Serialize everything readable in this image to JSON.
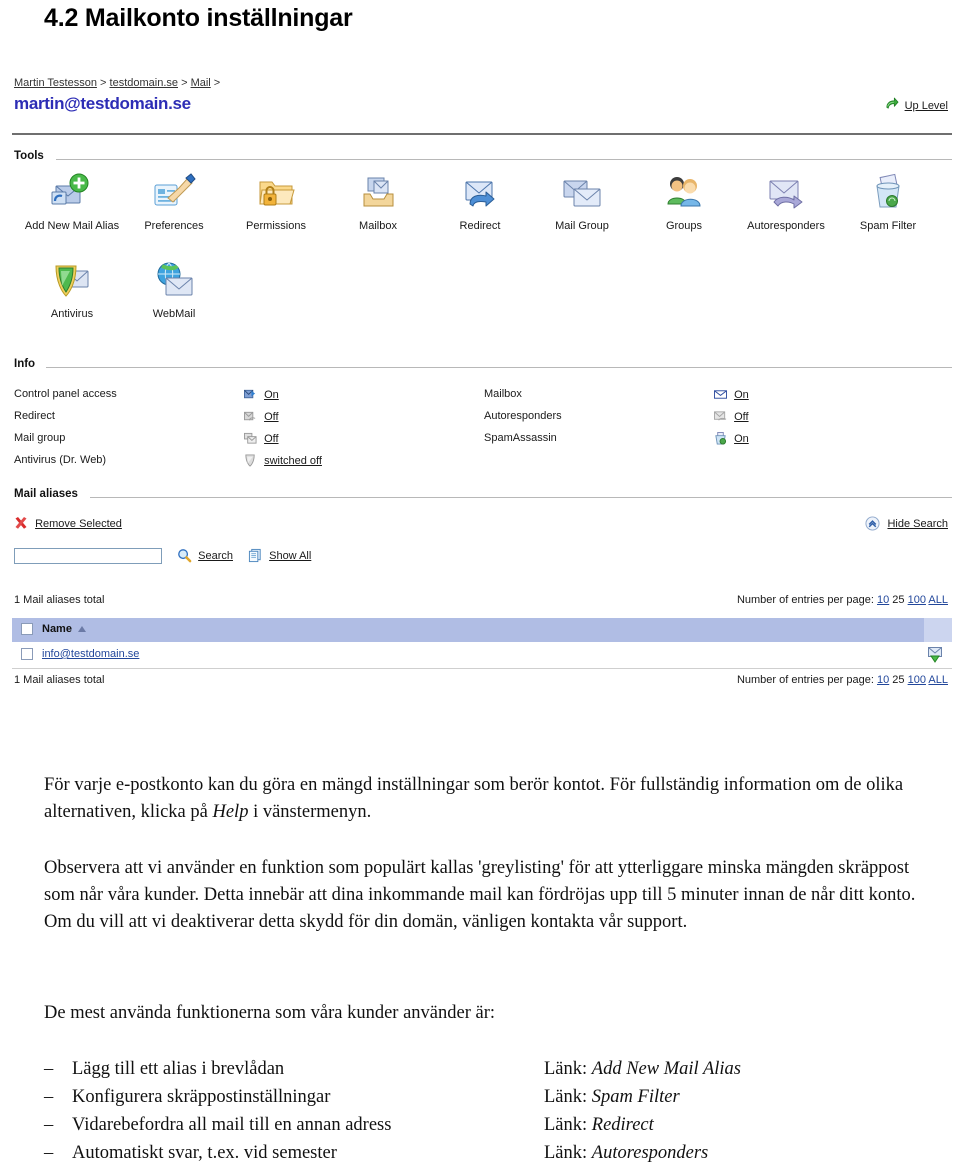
{
  "document": {
    "heading": "4.2 Mailkonto inställningar"
  },
  "panel": {
    "breadcrumb": {
      "items": [
        "Martin Testesson",
        "testdomain.se",
        "Mail"
      ],
      "separator": ">",
      "trailing": ">"
    },
    "account_title": "martin@testdomain.se",
    "up_level": {
      "label": "Up Level",
      "icon": "up-level-arrow-icon"
    },
    "sections": {
      "tools_label": "Tools",
      "info_label": "Info",
      "mail_aliases_label": "Mail aliases"
    },
    "tools": [
      {
        "label": "Add New Mail Alias",
        "icon": "add-mail-alias-icon"
      },
      {
        "label": "Preferences",
        "icon": "preferences-icon"
      },
      {
        "label": "Permissions",
        "icon": "permissions-lock-folder-icon"
      },
      {
        "label": "Mailbox",
        "icon": "mailbox-tray-icon"
      },
      {
        "label": "Redirect",
        "icon": "redirect-arrow-envelope-icon"
      },
      {
        "label": "Mail Group",
        "icon": "mail-group-envelopes-icon"
      },
      {
        "label": "Groups",
        "icon": "groups-people-icon"
      },
      {
        "label": "Autoresponders",
        "icon": "autoresponders-envelope-icon"
      },
      {
        "label": "Spam Filter",
        "icon": "spam-filter-bin-icon"
      },
      {
        "label": "Antivirus",
        "icon": "antivirus-shield-icon"
      },
      {
        "label": "WebMail",
        "icon": "webmail-globe-envelope-icon"
      }
    ],
    "info_left": [
      {
        "label": "Control panel access",
        "value": "On",
        "icon": "control-panel-icon"
      },
      {
        "label": "Redirect",
        "value": "Off",
        "icon": "redirect-off-icon"
      },
      {
        "label": "Mail group",
        "value": "Off",
        "icon": "mail-group-off-icon"
      },
      {
        "label": "Antivirus (Dr. Web)",
        "value": "switched off",
        "icon": "antivirus-shield-off-icon"
      }
    ],
    "info_right": [
      {
        "label": "Mailbox",
        "value": "On",
        "icon": "mailbox-envelope-icon"
      },
      {
        "label": "Autoresponders",
        "value": "Off",
        "icon": "autoresponder-off-icon"
      },
      {
        "label": "SpamAssassin",
        "value": "On",
        "icon": "spamassassin-bin-icon"
      }
    ],
    "aliases": {
      "remove_selected_label": "Remove Selected",
      "remove_selected_icon": "red-x-icon",
      "hide_search_label": "Hide Search",
      "hide_search_icon": "chevron-up-circle-icon",
      "search_value": "",
      "search_placeholder": "",
      "search_label": "Search",
      "search_icon": "magnifier-icon",
      "show_all_label": "Show All",
      "show_all_icon": "pages-icon",
      "total_label": "1 Mail aliases total",
      "per_page_label": "Number of entries per page:",
      "per_page_options": [
        "10",
        "25",
        "100",
        "ALL"
      ],
      "per_page_selected": "25",
      "column_name": "Name",
      "sort_direction": "asc",
      "rows": [
        {
          "name": "info@testdomain.se",
          "icon": "mail-forward-icon",
          "checked": false
        }
      ]
    }
  },
  "prose": {
    "p1_a": "För varje e-postkonto kan du göra en mängd inställningar som berör kontot. För fullständig information om de olika alternativen, klicka på ",
    "p1_em": "Help",
    "p1_b": " i vänstermenyn.",
    "p2": "Observera att vi använder en funktion som populärt kallas 'greylisting' för att ytterliggare minska mängden skräppost som når våra kunder. Detta innebär att dina inkommande mail kan fördröjas upp till 5 minuter innan de når ditt konto. Om du vill att vi deaktiverar detta skydd för din domän, vänligen kontakta vår support.",
    "p3": "De mest använda funktionerna som våra kunder använder är:"
  },
  "bullets": {
    "dash": "–",
    "link_prefix": "Länk:",
    "items": [
      {
        "text": "Lägg till ett alias i brevlådan",
        "link": "Add New Mail Alias"
      },
      {
        "text": "Konfigurera skräppostinställningar",
        "link": "Spam Filter"
      },
      {
        "text": "Vidarebefordra all mail till en annan adress",
        "link": "Redirect"
      },
      {
        "text": "Automatiskt svar, t.ex. vid semester",
        "link": "Autoresponders"
      }
    ]
  },
  "colors": {
    "account_blue": "#2d2db5",
    "link_blue": "#22479b",
    "header_row": "#b0bde4",
    "header_row_alt": "#ccd5ef",
    "rule": "#6f6f6f"
  }
}
